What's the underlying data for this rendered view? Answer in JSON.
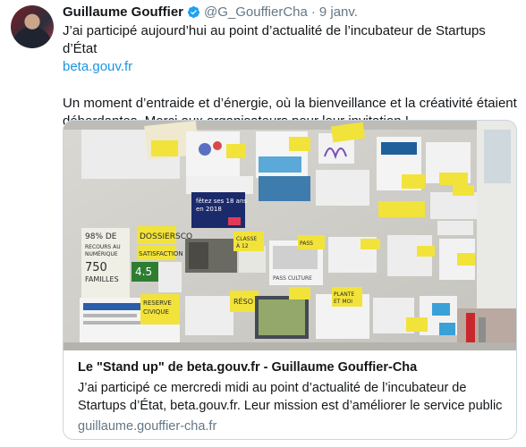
{
  "tweet": {
    "author_name": "Guillaume Gouffier",
    "handle": "@G_GouffierCha",
    "separator": "·",
    "date": "9 janv.",
    "line1": "J’ai participé aujourd’hui au point d’actualité de l’incubateur de Startups d’État",
    "link": "beta.gouv.fr",
    "paragraph2": "Un moment d’entraide et d’énergie, où la bienveillance et la créativité étaient débordantes. Merci aux organisateurs pour leur invitation !"
  },
  "card": {
    "title": "Le \"Stand up\" de beta.gouv.fr - Guillaume Gouffier-Cha",
    "description": "J’ai participé ce mercredi midi au point d’actualité de l’incubateur de Startups d’État, beta.gouv.fr. Leur mission est d’améliorer le service public",
    "domain": "guillaume.gouffier-cha.fr",
    "image_notes": {
      "note_dossiersco": "DOSSIERSCO",
      "note_satisfaction": "SATISFACTION",
      "note_reserve": "RESERVE CIVIQUE",
      "note_reso": "RÉSO",
      "note_plante": "PLANTE ET MOI",
      "note_classe": "CLASSE À 12",
      "note_pass": "PASS CULTURE",
      "note_families": "750 FAMILLES",
      "note_percent": "98% DE RECOURS AU NUMÉRIQUE",
      "note_value": "4.5",
      "poster_text": "fêtez ses 18 ans en 2018"
    }
  },
  "colors": {
    "text": "#14171a",
    "muted": "#657786",
    "link": "#1b95e0",
    "verified": "#1da1f2",
    "border": "#ccd6dd",
    "sticky": "#f2e33a"
  }
}
